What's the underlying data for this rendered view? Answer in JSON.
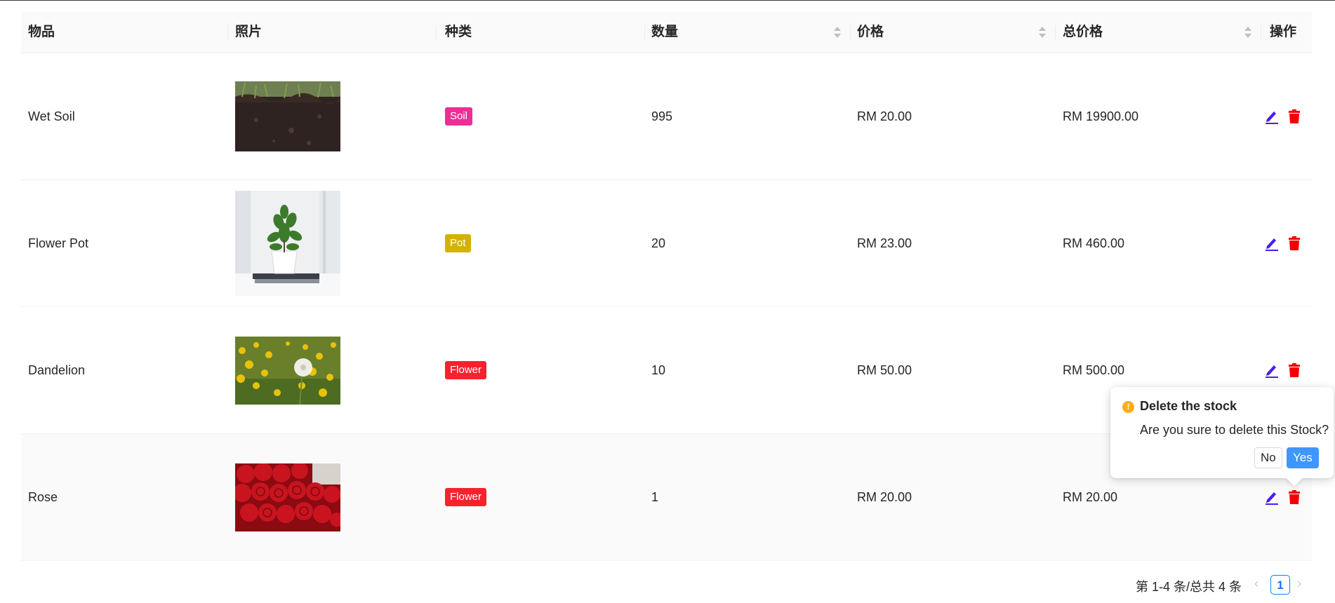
{
  "columns": [
    "物品",
    "照片",
    "种类",
    "数量",
    "价格",
    "总价格",
    "操作"
  ],
  "rows": [
    {
      "name": "Wet Soil",
      "photo": "soil-photo",
      "category": "Soil",
      "category_color": "#eb2f96",
      "quantity": "995",
      "price": "RM 20.00",
      "total": "RM 19900.00"
    },
    {
      "name": "Flower Pot",
      "photo": "potted-plant-photo",
      "category": "Pot",
      "category_color": "#d4b106",
      "quantity": "20",
      "price": "RM 23.00",
      "total": "RM 460.00"
    },
    {
      "name": "Dandelion",
      "photo": "dandelion-photo",
      "category": "Flower",
      "category_color": "#f5222d",
      "quantity": "10",
      "price": "RM 50.00",
      "total": "RM 500.00"
    },
    {
      "name": "Rose",
      "photo": "roses-photo",
      "category": "Flower",
      "category_color": "#f5222d",
      "quantity": "1",
      "price": "RM 20.00",
      "total": "RM 20.00"
    }
  ],
  "popconfirm": {
    "title": "Delete the stock",
    "description": "Are you sure to delete this Stock?",
    "no_label": "No",
    "yes_label": "Yes"
  },
  "pagination": {
    "total_text": "第 1-4 条/总共 4 条",
    "current_page": "1",
    "prev_icon": "‹",
    "next_icon": "›"
  },
  "colors": {
    "edit_icon": "#4b1cf0",
    "delete_icon": "#f50000",
    "primary": "#1677ff"
  },
  "icons": {
    "edit": "pencil-icon",
    "delete": "trash-icon",
    "warning": "exclamation-circle-icon",
    "sort": "sort-caret-icon"
  }
}
